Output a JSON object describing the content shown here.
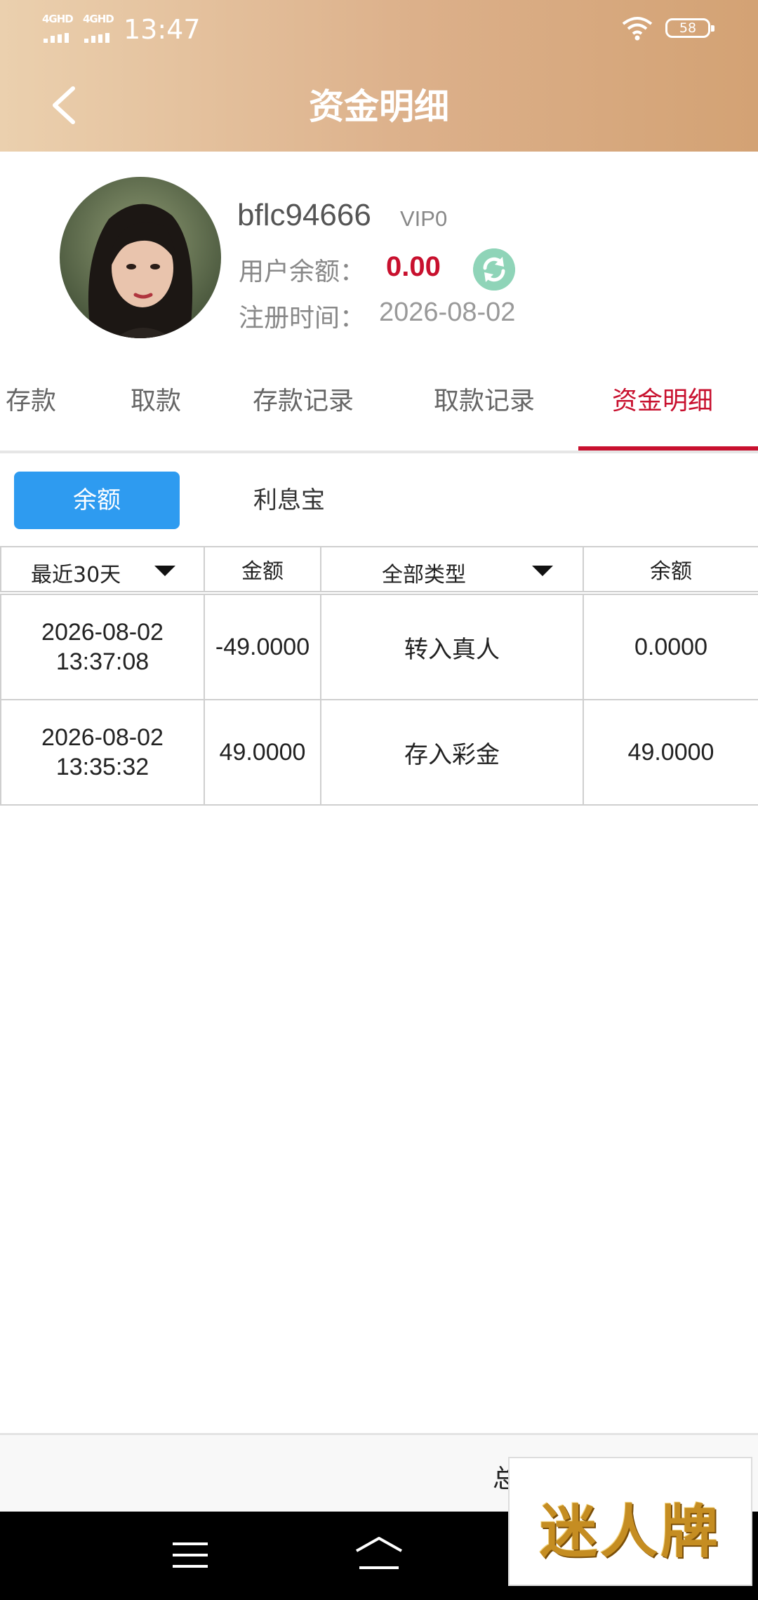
{
  "status_bar": {
    "network_1": "4GHD",
    "network_2": "4GHD",
    "time": "13:47",
    "battery": "58"
  },
  "header": {
    "title": "资金明细"
  },
  "profile": {
    "username": "bflc94666",
    "vip_level": "VIP0",
    "balance_label": "用户余额：",
    "balance_value": "0.00",
    "register_label": "注册时间：",
    "register_date": "2026-08-02"
  },
  "tabs": [
    {
      "label": "存款"
    },
    {
      "label": "取款"
    },
    {
      "label": "存款记录"
    },
    {
      "label": "取款记录"
    },
    {
      "label": "资金明细"
    }
  ],
  "subtabs": [
    {
      "label": "余额"
    },
    {
      "label": "利息宝"
    }
  ],
  "table": {
    "headers": [
      "最近30天",
      "金额",
      "全部类型",
      "余额"
    ],
    "rows": [
      {
        "date": "2026-08-02",
        "time": "13:37:08",
        "amount": "-49.0000",
        "type": "转入真人",
        "balance": "0.0000"
      },
      {
        "date": "2026-08-02",
        "time": "13:35:32",
        "amount": "49.0000",
        "type": "存入彩金",
        "balance": "49.0000"
      }
    ]
  },
  "footer": {
    "text": "总"
  },
  "watermark": {
    "text": "迷人牌"
  },
  "colors": {
    "accent_red": "#c8102e",
    "button_blue": "#2e9bf0",
    "header_gradient_start": "#ebd0ae",
    "header_gradient_end": "#d3a274"
  },
  "icons": [
    "back-arrow-icon",
    "refresh-icon",
    "wifi-icon",
    "dropdown-caret-icon",
    "menu-icon",
    "home-icon"
  ]
}
